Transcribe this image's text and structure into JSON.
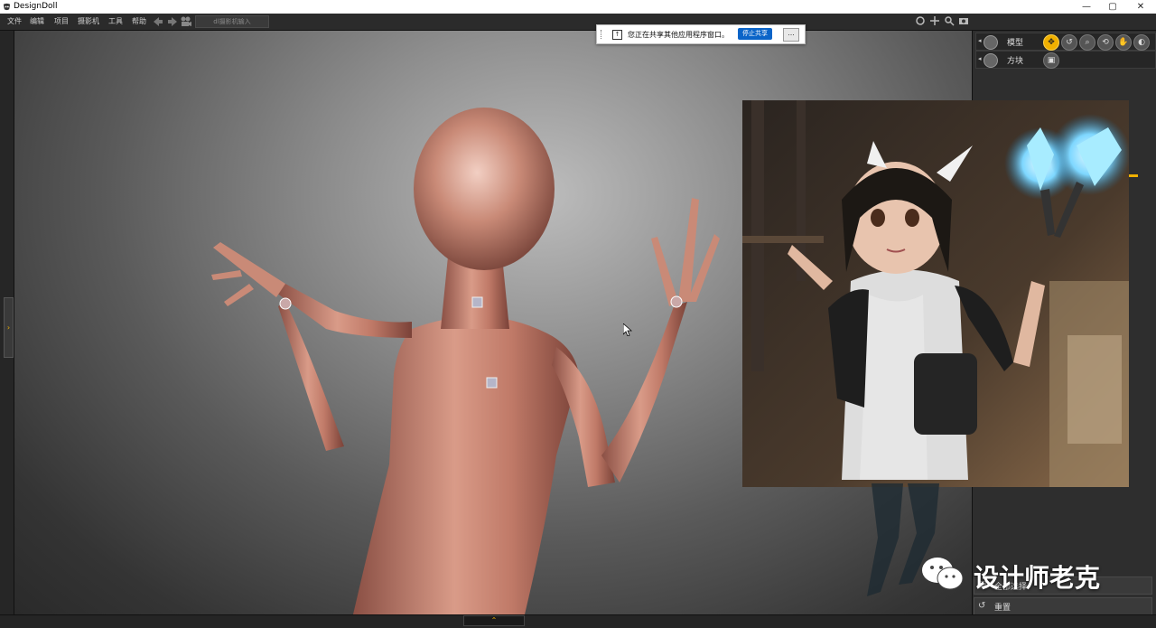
{
  "window": {
    "title": "DesignDoll",
    "controls": [
      "—",
      "▢",
      "✕"
    ]
  },
  "menu": {
    "items": [
      "文件",
      "编辑",
      "项目",
      "摄影机",
      "工具",
      "帮助"
    ],
    "camera_input_placeholder": "dl摄影机输入"
  },
  "share_bar": {
    "message": "您正在共享其他应用程序窗口。",
    "stop_label": "停止共享",
    "more_label": "..."
  },
  "right_panel": {
    "rows": [
      {
        "label": "模型"
      },
      {
        "label": "方块"
      }
    ],
    "buttons": [
      {
        "label": "全部选择"
      },
      {
        "label": "重置"
      }
    ]
  },
  "watermark": {
    "text": "设计师老克"
  },
  "colors": {
    "accent": "#f0b000",
    "share_stop": "#0a64c8",
    "skin": "#c98a77"
  }
}
